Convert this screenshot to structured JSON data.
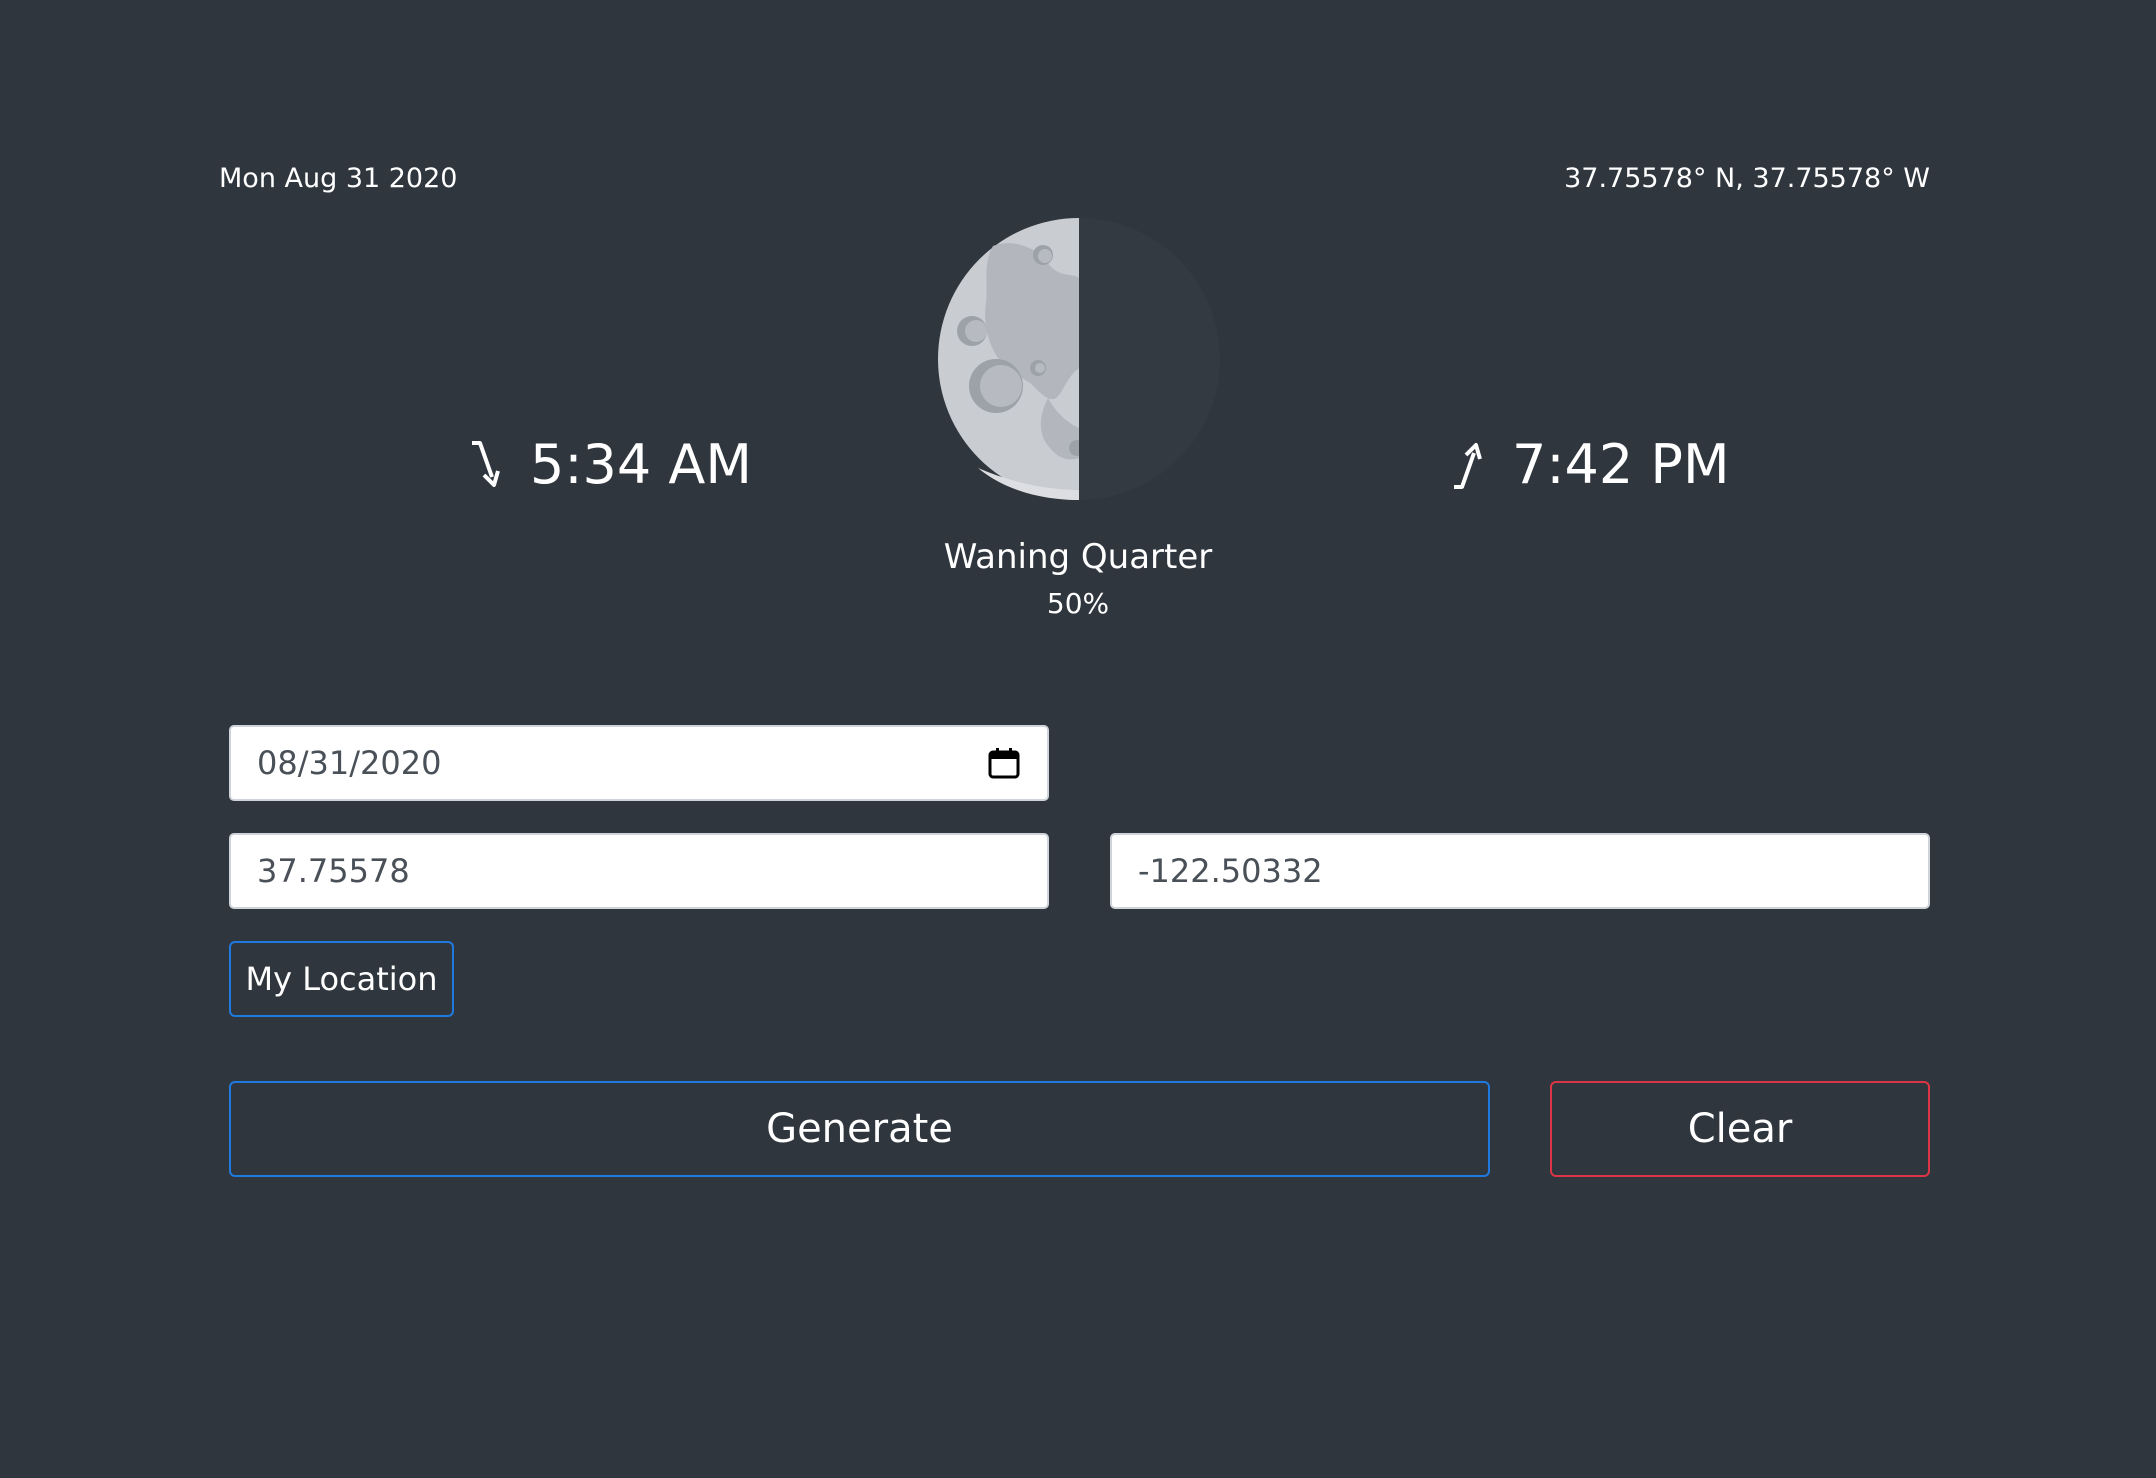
{
  "header": {
    "date": "Mon Aug 31 2020",
    "coordinates": "37.75578° N, 37.75578° W"
  },
  "moon": {
    "icon": "waning-quarter-moon-icon",
    "moonrise_time": "5:34 AM",
    "moonrise_icon": "moonrise-arrow-icon",
    "moonset_time": "7:42 PM",
    "moonset_icon": "moonset-arrow-icon",
    "phase_name": "Waning Quarter",
    "illumination": "50%"
  },
  "form": {
    "date_value": "08/31/2020",
    "calendar_icon": "calendar-icon",
    "latitude_value": "37.75578",
    "longitude_value": "-122.50332",
    "my_location_label": "My Location",
    "generate_label": "Generate",
    "clear_label": "Clear"
  },
  "colors": {
    "background": "#2f363d",
    "primary": "#1f7ae0",
    "danger": "#dc3545"
  }
}
